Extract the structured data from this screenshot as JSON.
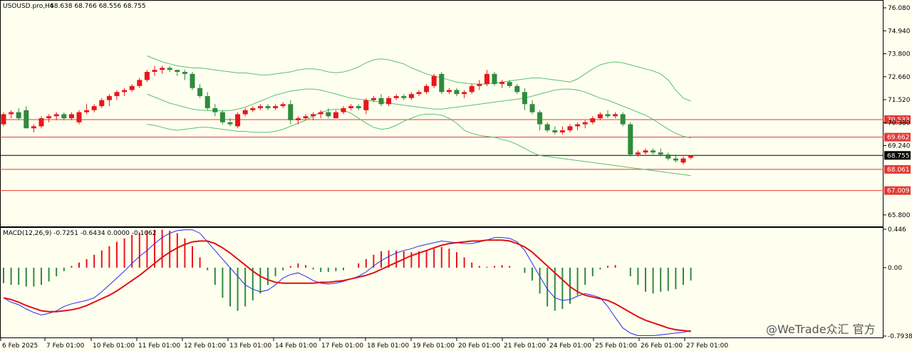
{
  "chart_data": {
    "type": "candlestick",
    "symbol_header": "USOUSD.pro,H4",
    "ohlc_header": "68.638 68.766 68.556 68.755",
    "x_labels": [
      "6 Feb 2025",
      "7 Feb 01:00",
      "10 Feb 01:00",
      "11 Feb 01:00",
      "12 Feb 01:00",
      "13 Feb 01:00",
      "14 Feb 01:00",
      "17 Feb 01:00",
      "18 Feb 01:00",
      "19 Feb 01:00",
      "20 Feb 01:00",
      "21 Feb 01:00",
      "24 Feb 01:00",
      "25 Feb 01:00",
      "26 Feb 01:00",
      "27 Feb 01:00"
    ],
    "price_axis": {
      "ticks": [
        "76.080",
        "74.940",
        "73.800",
        "72.660",
        "71.520",
        "70.380",
        "69.240",
        "65.800"
      ],
      "range": [
        65.3,
        76.4
      ]
    },
    "horizontal_levels": [
      {
        "label": "70.533",
        "value": 70.533,
        "color": "#e53935"
      },
      {
        "label": "69.662",
        "value": 69.662,
        "color": "#e53935"
      },
      {
        "label": "68.061",
        "value": 68.061,
        "color": "#e53935"
      },
      {
        "label": "67.009",
        "value": 67.009,
        "color": "#e53935"
      }
    ],
    "current_price": {
      "label": "68.755",
      "value": 68.755
    },
    "colors": {
      "up": "#e8161a",
      "down": "#2f8b3a",
      "band": "#5cbf6c",
      "macd_line": "#2a2af0",
      "signal_line": "#e01010",
      "level_tag_bg": "#e53935"
    },
    "candles": [
      [
        70.3,
        70.9,
        70.2,
        70.8
      ],
      [
        70.8,
        71.0,
        70.6,
        70.9
      ],
      [
        70.9,
        71.1,
        70.5,
        70.6
      ],
      [
        71.0,
        71.2,
        70.2,
        70.1
      ],
      [
        70.1,
        70.3,
        69.9,
        70.2
      ],
      [
        70.2,
        70.7,
        70.1,
        70.6
      ],
      [
        70.6,
        70.8,
        70.4,
        70.7
      ],
      [
        70.7,
        70.9,
        70.5,
        70.8
      ],
      [
        70.8,
        70.9,
        70.5,
        70.6
      ],
      [
        70.6,
        70.9,
        70.5,
        70.8
      ],
      [
        70.4,
        71.0,
        70.3,
        70.9
      ],
      [
        70.9,
        71.3,
        70.8,
        71.0
      ],
      [
        71.0,
        71.3,
        70.9,
        71.2
      ],
      [
        71.2,
        71.6,
        71.1,
        71.5
      ],
      [
        71.5,
        71.8,
        71.2,
        71.7
      ],
      [
        71.7,
        72.0,
        71.5,
        71.9
      ],
      [
        71.9,
        72.1,
        71.7,
        72.0
      ],
      [
        72.0,
        72.3,
        71.9,
        72.2
      ],
      [
        72.2,
        72.6,
        72.1,
        72.5
      ],
      [
        72.5,
        73.0,
        72.4,
        72.9
      ],
      [
        72.9,
        73.2,
        72.7,
        73.0
      ],
      [
        73.0,
        73.2,
        72.8,
        73.1
      ],
      [
        73.1,
        73.2,
        72.9,
        73.0
      ],
      [
        73.0,
        73.0,
        72.7,
        72.9
      ],
      [
        72.9,
        73.0,
        72.5,
        72.8
      ],
      [
        72.8,
        72.9,
        72.0,
        72.1
      ],
      [
        72.1,
        72.3,
        71.6,
        71.7
      ],
      [
        71.7,
        71.9,
        71.0,
        71.1
      ],
      [
        71.1,
        71.3,
        70.7,
        70.9
      ],
      [
        70.9,
        71.0,
        70.3,
        70.4
      ],
      [
        70.4,
        70.6,
        70.2,
        70.3
      ],
      [
        70.2,
        70.9,
        70.1,
        70.8
      ],
      [
        70.8,
        71.1,
        70.7,
        71.0
      ],
      [
        71.0,
        71.2,
        70.9,
        71.1
      ],
      [
        71.1,
        71.3,
        71.0,
        71.2
      ],
      [
        71.2,
        71.3,
        71.0,
        71.1
      ],
      [
        71.1,
        71.3,
        71.0,
        71.2
      ],
      [
        71.2,
        71.4,
        71.1,
        71.3
      ],
      [
        71.3,
        71.5,
        70.3,
        70.5
      ],
      [
        70.5,
        70.7,
        70.3,
        70.6
      ],
      [
        70.6,
        70.8,
        70.5,
        70.7
      ],
      [
        70.7,
        70.9,
        70.5,
        70.8
      ],
      [
        70.8,
        71.0,
        70.6,
        70.9
      ],
      [
        70.9,
        71.1,
        70.6,
        70.7
      ],
      [
        70.6,
        71.0,
        70.6,
        70.9
      ],
      [
        70.9,
        71.2,
        70.8,
        71.1
      ],
      [
        71.1,
        71.3,
        71.0,
        71.2
      ],
      [
        71.2,
        71.3,
        71.0,
        71.1
      ],
      [
        71.0,
        71.6,
        70.8,
        71.5
      ],
      [
        71.5,
        71.7,
        71.4,
        71.6
      ],
      [
        71.6,
        71.8,
        71.2,
        71.3
      ],
      [
        71.3,
        71.7,
        71.2,
        71.6
      ],
      [
        71.6,
        71.8,
        71.5,
        71.7
      ],
      [
        71.7,
        71.8,
        71.5,
        71.6
      ],
      [
        71.6,
        71.9,
        71.5,
        71.8
      ],
      [
        71.8,
        72.0,
        71.7,
        71.9
      ],
      [
        71.9,
        72.3,
        71.8,
        72.2
      ],
      [
        72.2,
        72.8,
        72.1,
        72.7
      ],
      [
        72.8,
        72.9,
        71.8,
        71.9
      ],
      [
        71.9,
        72.1,
        71.8,
        72.0
      ],
      [
        72.0,
        72.1,
        71.7,
        71.8
      ],
      [
        71.8,
        72.0,
        71.6,
        71.9
      ],
      [
        71.9,
        72.3,
        71.8,
        72.2
      ],
      [
        72.2,
        72.5,
        72.0,
        72.3
      ],
      [
        72.3,
        73.0,
        72.2,
        72.8
      ],
      [
        72.8,
        72.9,
        72.2,
        72.3
      ],
      [
        72.3,
        72.5,
        72.1,
        72.4
      ],
      [
        72.4,
        72.5,
        72.1,
        72.2
      ],
      [
        72.2,
        72.3,
        71.8,
        71.9
      ],
      [
        71.9,
        72.1,
        71.0,
        71.3
      ],
      [
        71.3,
        71.5,
        70.8,
        70.9
      ],
      [
        70.9,
        71.0,
        70.0,
        70.3
      ],
      [
        70.3,
        70.4,
        69.9,
        70.0
      ],
      [
        70.0,
        70.2,
        69.8,
        69.9
      ],
      [
        69.9,
        70.2,
        69.8,
        70.0
      ],
      [
        70.0,
        70.3,
        69.9,
        70.2
      ],
      [
        70.2,
        70.4,
        70.0,
        70.3
      ],
      [
        70.3,
        70.5,
        70.1,
        70.4
      ],
      [
        70.4,
        70.7,
        70.3,
        70.6
      ],
      [
        70.6,
        70.9,
        70.5,
        70.8
      ],
      [
        70.8,
        71.0,
        70.6,
        70.7
      ],
      [
        70.7,
        70.9,
        70.6,
        70.8
      ],
      [
        70.8,
        70.9,
        70.2,
        70.3
      ],
      [
        70.3,
        70.4,
        68.7,
        68.8
      ],
      [
        68.8,
        69.0,
        68.7,
        68.9
      ],
      [
        68.9,
        69.1,
        68.8,
        69.0
      ],
      [
        69.0,
        69.1,
        68.8,
        68.9
      ],
      [
        68.9,
        69.1,
        68.7,
        68.8
      ],
      [
        68.8,
        68.9,
        68.5,
        68.6
      ],
      [
        68.6,
        68.8,
        68.4,
        68.5
      ],
      [
        68.4,
        68.7,
        68.3,
        68.6
      ],
      [
        68.638,
        68.766,
        68.556,
        68.755
      ]
    ],
    "bollinger": {
      "upper": [
        73.7,
        73.55,
        73.4,
        73.3,
        73.2,
        73.15,
        73.1,
        73.1,
        73.05,
        73.0,
        72.95,
        72.9,
        72.85,
        72.85,
        72.8,
        72.75,
        72.75,
        72.8,
        72.85,
        72.9,
        73.0,
        73.05,
        73.05,
        73.0,
        72.9,
        72.85,
        72.9,
        73.0,
        73.15,
        73.35,
        73.5,
        73.55,
        73.5,
        73.4,
        73.3,
        73.1,
        72.95,
        72.8,
        72.7,
        72.6,
        72.5,
        72.4,
        72.35,
        72.3,
        72.3,
        72.3,
        72.35,
        72.4,
        72.45,
        72.5,
        72.55,
        72.6,
        72.6,
        72.55,
        72.5,
        72.45,
        72.4,
        72.55,
        72.8,
        73.05,
        73.25,
        73.35,
        73.4,
        73.35,
        73.25,
        73.15,
        73.05,
        72.95,
        72.8,
        72.5,
        72.0,
        71.6,
        71.45
      ],
      "middle": [
        71.8,
        71.65,
        71.5,
        71.35,
        71.25,
        71.15,
        71.05,
        71.0,
        70.98,
        70.97,
        70.97,
        70.98,
        71.05,
        71.15,
        71.3,
        71.45,
        71.6,
        71.75,
        71.85,
        71.95,
        72.0,
        72.05,
        72.05,
        72.0,
        71.9,
        71.8,
        71.7,
        71.6,
        71.55,
        71.5,
        71.45,
        71.4,
        71.35,
        71.3,
        71.25,
        71.2,
        71.15,
        71.1,
        71.05,
        71.05,
        71.1,
        71.15,
        71.2,
        71.25,
        71.3,
        71.35,
        71.4,
        71.45,
        71.5,
        71.55,
        71.6,
        71.7,
        71.8,
        71.9,
        72.0,
        72.05,
        72.05,
        72.0,
        71.9,
        71.75,
        71.6,
        71.5,
        71.35,
        71.2,
        71.05,
        70.9,
        70.75,
        70.55,
        70.3,
        70.05,
        69.85,
        69.7,
        69.62
      ],
      "lower": [
        70.3,
        70.25,
        70.15,
        70.05,
        70.0,
        70.05,
        70.1,
        70.15,
        70.15,
        70.1,
        70.05,
        70.0,
        69.95,
        69.95,
        69.9,
        69.9,
        69.9,
        69.95,
        70.05,
        70.2,
        70.35,
        70.5,
        70.7,
        70.9,
        71.0,
        71.05,
        71.0,
        70.85,
        70.6,
        70.35,
        70.15,
        70.05,
        70.1,
        70.25,
        70.45,
        70.6,
        70.75,
        70.8,
        70.8,
        70.75,
        70.6,
        70.35,
        70.0,
        69.85,
        69.75,
        69.7,
        69.65,
        69.55,
        69.45,
        69.3,
        69.1,
        68.9,
        68.75,
        68.7,
        68.65,
        68.6,
        68.55,
        68.5,
        68.45,
        68.4,
        68.35,
        68.3,
        68.25,
        68.2,
        68.15,
        68.1,
        68.05,
        68.0,
        67.95,
        67.9,
        67.85,
        67.8,
        67.75
      ]
    },
    "macd_panel": {
      "label": "MACD(12,26,9) -0.7251 -0.6434 0.0000 -0.1062",
      "ticks": [
        "0.446",
        "0.00",
        "-0.7938"
      ],
      "range": [
        -0.7938,
        0.446
      ],
      "histogram": [
        -0.18,
        -0.2,
        -0.2,
        -0.22,
        -0.22,
        -0.2,
        -0.16,
        -0.1,
        -0.04,
        0.02,
        0.06,
        0.1,
        0.15,
        0.2,
        0.25,
        0.3,
        0.34,
        0.38,
        0.41,
        0.43,
        0.44,
        0.44,
        0.43,
        0.4,
        0.34,
        0.25,
        0.12,
        -0.03,
        -0.2,
        -0.35,
        -0.45,
        -0.5,
        -0.45,
        -0.38,
        -0.3,
        -0.2,
        -0.1,
        -0.03,
        0.02,
        0.05,
        0.03,
        -0.02,
        -0.05,
        -0.05,
        -0.04,
        -0.03,
        0.0,
        0.05,
        0.1,
        0.15,
        0.19,
        0.2,
        0.2,
        0.19,
        0.18,
        0.19,
        0.2,
        0.22,
        0.24,
        0.22,
        0.18,
        0.12,
        0.06,
        0.02,
        0.01,
        0.02,
        0.03,
        0.02,
        0.0,
        -0.06,
        -0.15,
        -0.3,
        -0.45,
        -0.5,
        -0.48,
        -0.42,
        -0.32,
        -0.2,
        -0.1,
        -0.02,
        0.02,
        0.03,
        0.0,
        -0.1,
        -0.2,
        -0.28,
        -0.3,
        -0.28,
        -0.27,
        -0.25,
        -0.2,
        -0.15
      ],
      "macd_line": [
        -0.35,
        -0.4,
        -0.43,
        -0.48,
        -0.52,
        -0.55,
        -0.53,
        -0.5,
        -0.45,
        -0.42,
        -0.4,
        -0.38,
        -0.35,
        -0.28,
        -0.2,
        -0.12,
        -0.04,
        0.05,
        0.13,
        0.2,
        0.28,
        0.35,
        0.4,
        0.43,
        0.44,
        0.44,
        0.4,
        0.3,
        0.2,
        0.1,
        0.0,
        -0.1,
        -0.2,
        -0.25,
        -0.28,
        -0.26,
        -0.2,
        -0.12,
        -0.08,
        -0.06,
        -0.1,
        -0.15,
        -0.18,
        -0.19,
        -0.18,
        -0.16,
        -0.13,
        -0.1,
        -0.05,
        0.02,
        0.08,
        0.13,
        0.17,
        0.2,
        0.22,
        0.25,
        0.27,
        0.29,
        0.31,
        0.3,
        0.29,
        0.28,
        0.28,
        0.3,
        0.32,
        0.35,
        0.35,
        0.34,
        0.3,
        0.2,
        0.05,
        -0.1,
        -0.25,
        -0.35,
        -0.38,
        -0.37,
        -0.33,
        -0.3,
        -0.32,
        -0.35,
        -0.45,
        -0.58,
        -0.7,
        -0.76,
        -0.79,
        -0.79,
        -0.79,
        -0.78,
        -0.77,
        -0.76,
        -0.75,
        -0.73
      ],
      "signal_line": [
        -0.35,
        -0.37,
        -0.4,
        -0.44,
        -0.47,
        -0.5,
        -0.51,
        -0.51,
        -0.5,
        -0.49,
        -0.47,
        -0.44,
        -0.4,
        -0.36,
        -0.32,
        -0.27,
        -0.21,
        -0.15,
        -0.09,
        -0.02,
        0.05,
        0.12,
        0.18,
        0.23,
        0.27,
        0.3,
        0.31,
        0.31,
        0.28,
        0.23,
        0.17,
        0.1,
        0.03,
        -0.04,
        -0.1,
        -0.14,
        -0.17,
        -0.18,
        -0.18,
        -0.18,
        -0.18,
        -0.18,
        -0.17,
        -0.17,
        -0.16,
        -0.15,
        -0.13,
        -0.11,
        -0.09,
        -0.06,
        -0.02,
        0.02,
        0.06,
        0.1,
        0.14,
        0.17,
        0.2,
        0.23,
        0.26,
        0.28,
        0.29,
        0.3,
        0.31,
        0.31,
        0.32,
        0.32,
        0.32,
        0.31,
        0.28,
        0.24,
        0.18,
        0.1,
        0.02,
        -0.06,
        -0.14,
        -0.22,
        -0.28,
        -0.32,
        -0.34,
        -0.36,
        -0.38,
        -0.42,
        -0.47,
        -0.52,
        -0.57,
        -0.61,
        -0.64,
        -0.67,
        -0.7,
        -0.72,
        -0.73,
        -0.74
      ]
    }
  },
  "watermark": "@WeTrade众汇 官方"
}
